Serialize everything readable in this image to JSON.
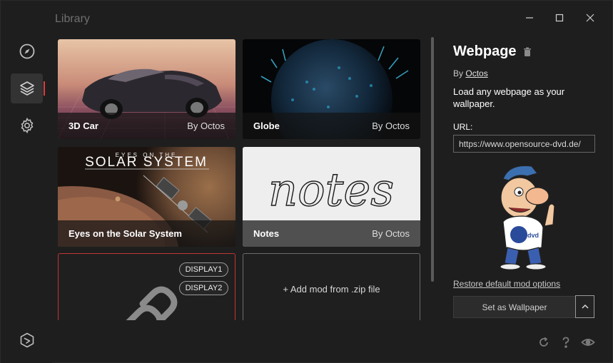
{
  "window": {
    "title": "Library"
  },
  "grid": {
    "cards": [
      {
        "name": "3D Car",
        "author": "By Octos"
      },
      {
        "name": "Globe",
        "author": "By Octos"
      },
      {
        "name": "Eyes on the Solar System",
        "author": "",
        "art_text_top": "EYES ON THE",
        "art_text_main": "SOLAR SYSTEM"
      },
      {
        "name": "Notes",
        "author": "By Octos",
        "art_text": "notes"
      }
    ],
    "display_pills": [
      "DISPLAY1",
      "DISPLAY2"
    ],
    "add_mod_label": "+ Add mod from .zip file"
  },
  "panel": {
    "title": "Webpage",
    "author_prefix": "By",
    "author_name": "Octos",
    "description": "Load any webpage as your wallpaper.",
    "url_label": "URL:",
    "url_value": "https://www.opensource-dvd.de/",
    "mascot_badge": "dvd",
    "restore_label": "Restore default mod options",
    "set_wallpaper_label": "Set as Wallpaper"
  },
  "colors": {
    "accent": "#e03c3c",
    "background": "#1e1e1e",
    "card_footer": "#141414"
  }
}
